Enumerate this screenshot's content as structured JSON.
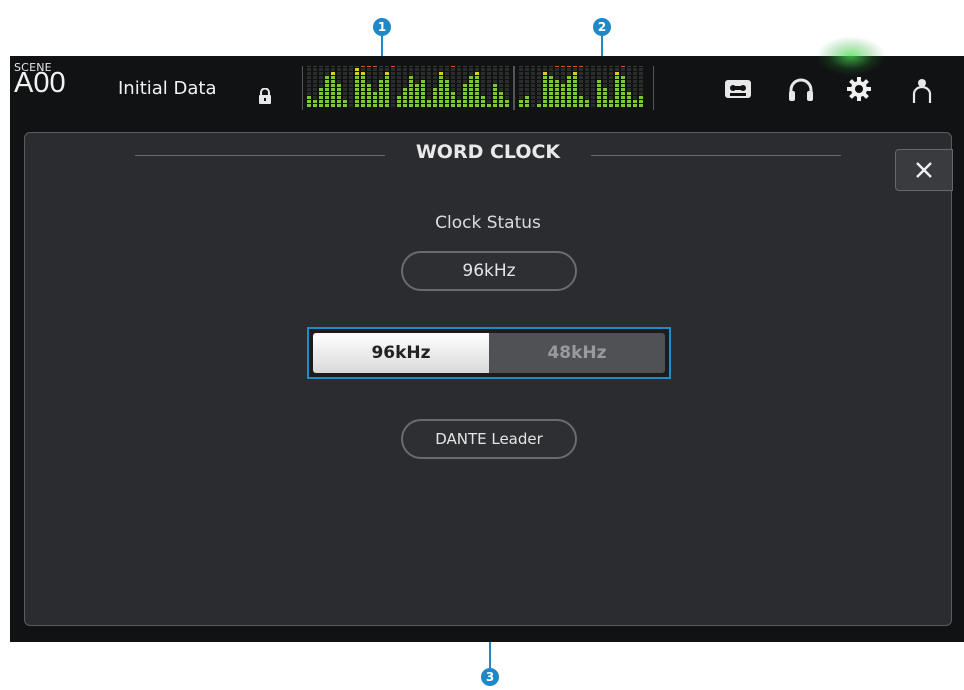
{
  "header": {
    "scene_label": "SCENE",
    "scene_number": "A00",
    "scene_name": "Initial Data",
    "icons": [
      "lock-icon",
      "recorder-icon",
      "headphones-icon",
      "gear-icon",
      "user-icon"
    ]
  },
  "dialog": {
    "title": "WORD CLOCK",
    "close_icon": "close-icon",
    "clock_status_label": "Clock Status",
    "clock_status_value": "96kHz",
    "rate_options": [
      "96kHz",
      "48kHz"
    ],
    "selected_rate": "96kHz",
    "leader_status": "DANTE Leader"
  },
  "callouts": [
    "1",
    "2",
    "3"
  ],
  "colors": {
    "accent": "#1e88c8",
    "panel_bg": "#2b2c2f",
    "meter_green": "#7bc832",
    "meter_yellow": "#d8d020",
    "meter_red": "#e0502a"
  }
}
